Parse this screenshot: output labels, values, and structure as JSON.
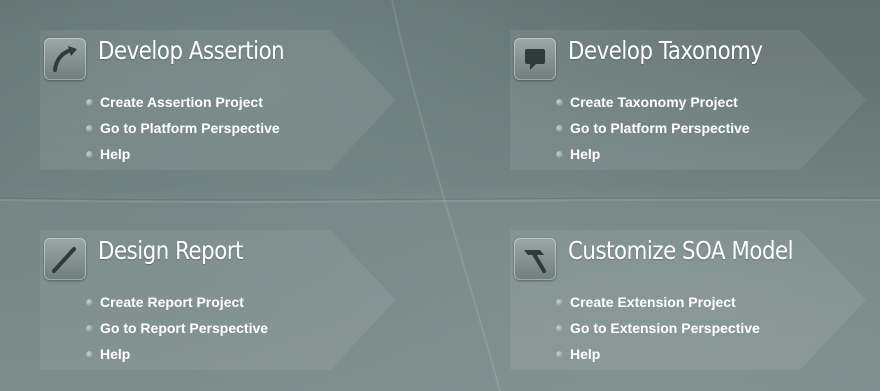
{
  "sections": [
    {
      "title": "Develop Assertion",
      "icon": "assertion-arrow-icon",
      "links": [
        "Create Assertion Project",
        "Go to Platform Perspective",
        "Help"
      ]
    },
    {
      "title": "Develop Taxonomy",
      "icon": "taxonomy-speech-bubble-icon",
      "links": [
        "Create Taxonomy Project",
        "Go to Platform Perspective",
        "Help"
      ]
    },
    {
      "title": "Design Report",
      "icon": "report-pen-icon",
      "links": [
        "Create Report Project",
        "Go to Report Perspective",
        "Help"
      ]
    },
    {
      "title": "Customize SOA Model",
      "icon": "hammer-icon",
      "links": [
        "Create Extension Project",
        "Go to Extension Perspective",
        "Help"
      ]
    }
  ],
  "colors": {
    "background": "#6b7c7b",
    "text": "#ffffff"
  }
}
